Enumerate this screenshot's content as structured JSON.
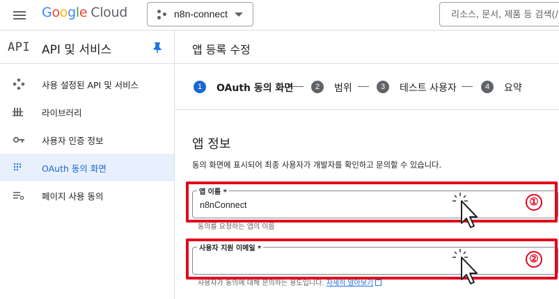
{
  "header": {
    "logo_google": [
      "G",
      "o",
      "o",
      "g",
      "l",
      "e"
    ],
    "logo_cloud": "Cloud",
    "project": "n8n-connect",
    "search_placeholder": "리소스, 문서, 제품 등 검색(/)"
  },
  "sidebar": {
    "badge": "API",
    "title": "API 및 서비스",
    "items": [
      {
        "label": "사용 설정된 API 및 서비스",
        "icon": "api-diamond-icon"
      },
      {
        "label": "라이브러리",
        "icon": "library-icon"
      },
      {
        "label": "사용자 인증 정보",
        "icon": "key-icon"
      },
      {
        "label": "OAuth 동의 화면",
        "icon": "oauth-dots-icon",
        "active": true
      },
      {
        "label": "페이지 사용 동의",
        "icon": "settings-list-icon"
      }
    ]
  },
  "main": {
    "title": "앱 등록 수정",
    "steps": [
      {
        "num": "1",
        "label": "OAuth 동의 화면",
        "active": true
      },
      {
        "num": "2",
        "label": "범위"
      },
      {
        "num": "3",
        "label": "테스트 사용자"
      },
      {
        "num": "4",
        "label": "요약"
      }
    ],
    "section_title": "앱 정보",
    "section_desc": "동의 화면에 표시되어 최종 사용자가 개발자를 확인하고 문의할 수 있습니다.",
    "fields": [
      {
        "label": "앱 이름 *",
        "value": "n8nConnect",
        "hint": "동의를 요청하는 앱의 이름"
      },
      {
        "label": "사용자 지원 이메일 *",
        "value": "",
        "hint": "사용자가 동의에 대해 문의하는 용도입니다.",
        "hint_link": "자세히 알아보기"
      }
    ]
  },
  "annotations": {
    "markers": [
      "①",
      "②"
    ]
  },
  "colors": {
    "accent": "#1a73e8",
    "active_step": "#1967d2",
    "inactive_step": "#5f6368",
    "highlight": "#e3041b",
    "active_nav_bg": "#e8f0fe"
  }
}
